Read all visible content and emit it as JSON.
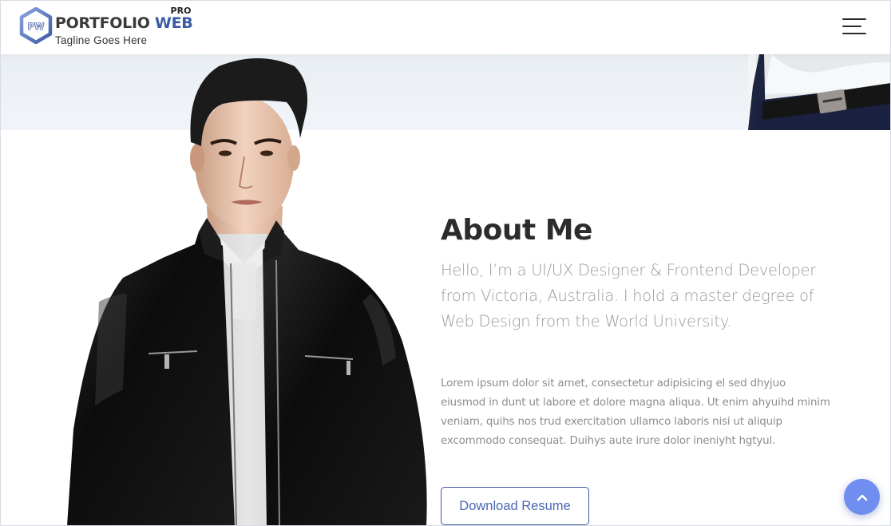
{
  "header": {
    "logo": {
      "badge_text": "PW",
      "name_part1": "PORTFOLIO",
      "name_part2": "WEB",
      "edition": "PRO",
      "tagline": "Tagline Goes Here"
    },
    "menu_icon": "hamburger-menu-icon"
  },
  "about": {
    "title": "About Me",
    "lead": "Hello, I’m a UI/UX Designer & Frontend Developer from Victoria, Australia. I hold a master degree of Web Design from the World University.",
    "body": "Lorem ipsum dolor sit amet, consectetur adipisicing el sed dhyjuo eiusmod in dunt ut labore et dolore magna aliqua. Ut enim ahyuihd minim veniam, quihs nos trud exercitation ullamco laboris nisi ut aliquip excommodo consequat. Duihys aute irure dolor ineniyht hgtyul.",
    "download_button": "Download Resume",
    "portrait_alt": "Man in black leather jacket and white polo shirt"
  },
  "scroll_top": {
    "icon": "chevron-up-icon"
  },
  "colors": {
    "brand": "#3b5aa6",
    "accent": "#6f8ef0",
    "heading": "#2c2c2c",
    "text_muted": "#9a9a9a"
  }
}
